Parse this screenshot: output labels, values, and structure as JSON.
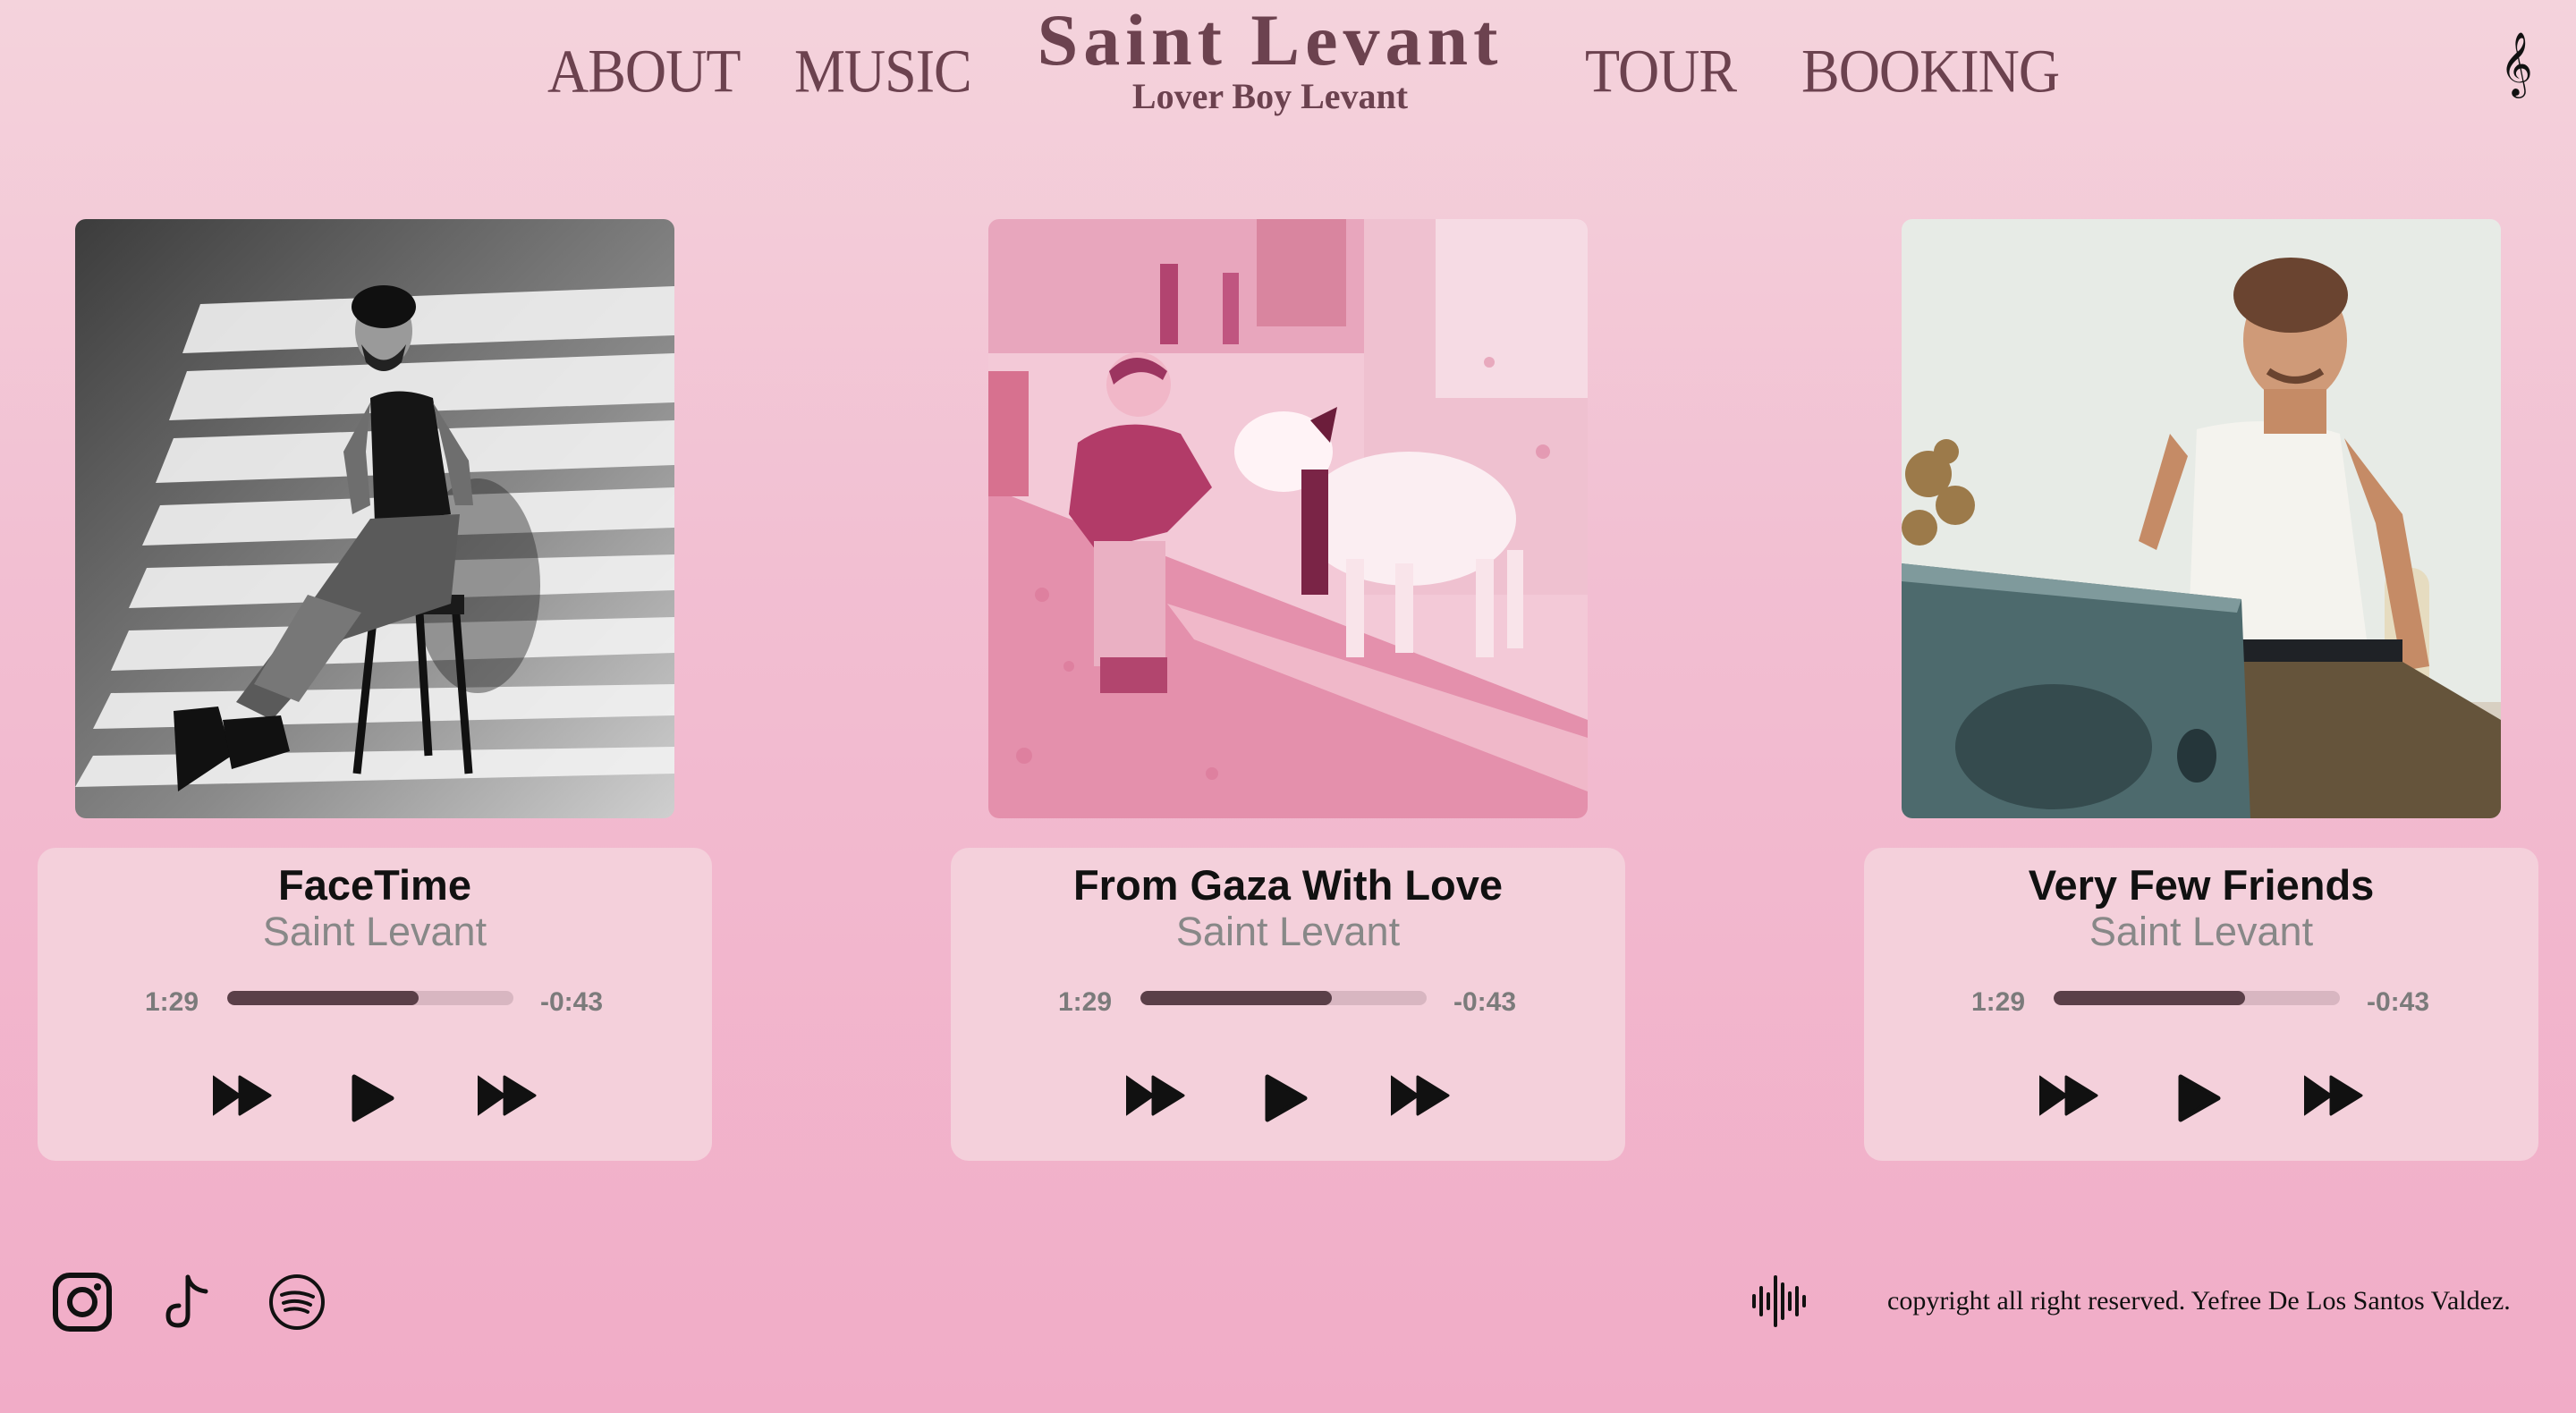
{
  "nav": {
    "items": [
      {
        "label": "ABOUT"
      },
      {
        "label": "MUSIC"
      },
      {
        "label": "TOUR"
      },
      {
        "label": "BOOKING"
      }
    ]
  },
  "brand": {
    "title": "Saint Levant",
    "subtitle": "Lover Boy Levant"
  },
  "header_icon": "treble-clef-icon",
  "tracks": [
    {
      "title": "FaceTime",
      "artist": "Saint Levant",
      "elapsed": "1:29",
      "remaining": "-0:43",
      "progress": 0.67,
      "artwork": "black-and-white photo of man seated on stool with window light stripes"
    },
    {
      "title": "From Gaza With Love",
      "artist": "Saint Levant",
      "elapsed": "1:29",
      "remaining": "-0:43",
      "progress": 0.67,
      "artwork": "pink duotone photo of child petting a goat on a street"
    },
    {
      "title": "Very Few Friends",
      "artist": "Saint Levant",
      "elapsed": "1:29",
      "remaining": "-0:43",
      "progress": 0.67,
      "artwork": "color photo of man in white tank top seated behind a speaker"
    }
  ],
  "player_controls": [
    "skip-back-icon",
    "play-icon",
    "skip-forward-icon"
  ],
  "footer": {
    "social": [
      "instagram-icon",
      "tiktok-icon",
      "spotify-icon"
    ],
    "audio_icon": "sound-wave-icon",
    "copyright": "copyright all right reserved. Yefree De Los Santos Valdez."
  },
  "colors": {
    "accent_text": "#6c424f",
    "player_bg": "#f4d0db",
    "progress_fill": "#5a3f48",
    "bg_top": "#f4d3dc",
    "bg_bottom": "#f1acc7"
  }
}
